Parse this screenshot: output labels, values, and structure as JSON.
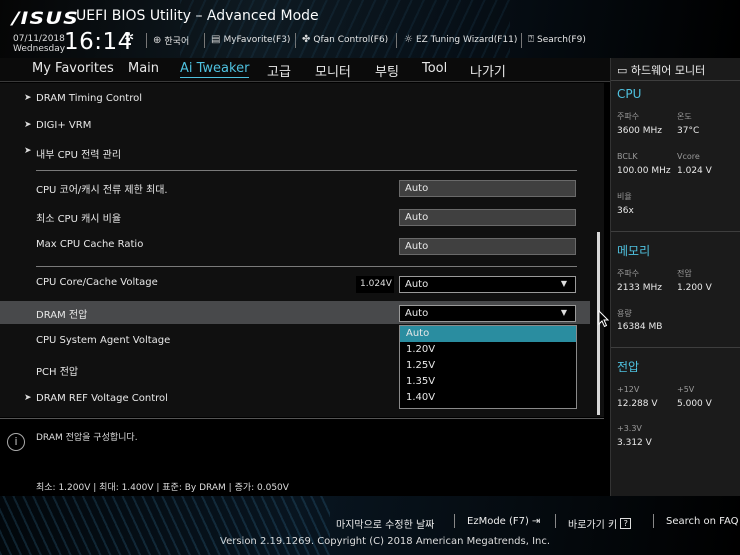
{
  "header": {
    "logo": "/ISUS",
    "title": "UEFI BIOS Utility – Advanced Mode",
    "date": "07/11/2018",
    "day": "Wednesday",
    "time": "16:14",
    "tools": {
      "language": "한국어",
      "myfavorite": "MyFavorite(F3)",
      "qfan": "Qfan Control(F6)",
      "ez_tuning": "EZ Tuning Wizard(F11)",
      "search": "Search(F9)"
    }
  },
  "tabs": [
    {
      "label": "My Favorites"
    },
    {
      "label": "Main"
    },
    {
      "label": "Ai Tweaker",
      "active": true
    },
    {
      "label": "고급"
    },
    {
      "label": "모니터"
    },
    {
      "label": "부팅"
    },
    {
      "label": "Tool"
    },
    {
      "label": "나가기"
    }
  ],
  "settings": {
    "dram_timing": "DRAM Timing Control",
    "digi_vrm": "DIGI+ VRM",
    "cpu_power": "내부 CPU 전력 관리",
    "cpu_core_cache_limit": {
      "label": "CPU 코어/캐시 전류 제한 최대.",
      "value": "Auto"
    },
    "min_cpu_cache_ratio": {
      "label": "최소 CPU 캐시 비율",
      "value": "Auto"
    },
    "max_cpu_cache_ratio": {
      "label": "Max CPU Cache Ratio",
      "value": "Auto"
    },
    "cpu_core_voltage": {
      "label": "CPU Core/Cache Voltage",
      "reading": "1.024V",
      "value": "Auto"
    },
    "dram_voltage": {
      "label": "DRAM 전압",
      "value": "Auto"
    },
    "cpu_sa_voltage": {
      "label": "CPU System Agent Voltage"
    },
    "pch_voltage": {
      "label": "PCH 전압"
    },
    "dram_ref_voltage": "DRAM REF Voltage Control"
  },
  "dropdown_options": [
    "Auto",
    "1.20V",
    "1.25V",
    "1.35V",
    "1.40V"
  ],
  "help": {
    "description": "DRAM 전압을 구성합니다.",
    "range": "최소: 1.200V   |   최대: 1.400V   |   표준: By DRAM   |   증가: 0.050V"
  },
  "hw_monitor": {
    "title": "하드웨어 모니터",
    "cpu": {
      "heading": "CPU",
      "freq_label": "주파수",
      "freq": "3600 MHz",
      "temp_label": "온도",
      "temp": "37°C",
      "bclk_label": "BCLK",
      "bclk": "100.00 MHz",
      "vcore_label": "Vcore",
      "vcore": "1.024 V",
      "ratio_label": "비율",
      "ratio": "36x"
    },
    "memory": {
      "heading": "메모리",
      "freq_label": "주파수",
      "freq": "2133 MHz",
      "volt_label": "전압",
      "volt": "1.200 V",
      "cap_label": "용량",
      "cap": "16384 MB"
    },
    "voltage": {
      "heading": "전압",
      "v12_label": "+12V",
      "v12": "12.288 V",
      "v5_label": "+5V",
      "v5": "5.000 V",
      "v33_label": "+3.3V",
      "v33": "3.312 V"
    }
  },
  "footer": {
    "last_modified": "마지막으로 수정한 날짜",
    "ezmode": "EzMode (F7)",
    "hotkeys": "바로가기 키",
    "faq": "Search on FAQ",
    "copyright": "Version 2.19.1269. Copyright (C) 2018 American Megatrends, Inc."
  },
  "colors": {
    "accent": "#4fc1df",
    "selected_option": "#2a8da0",
    "selected_row": "#48494b"
  }
}
